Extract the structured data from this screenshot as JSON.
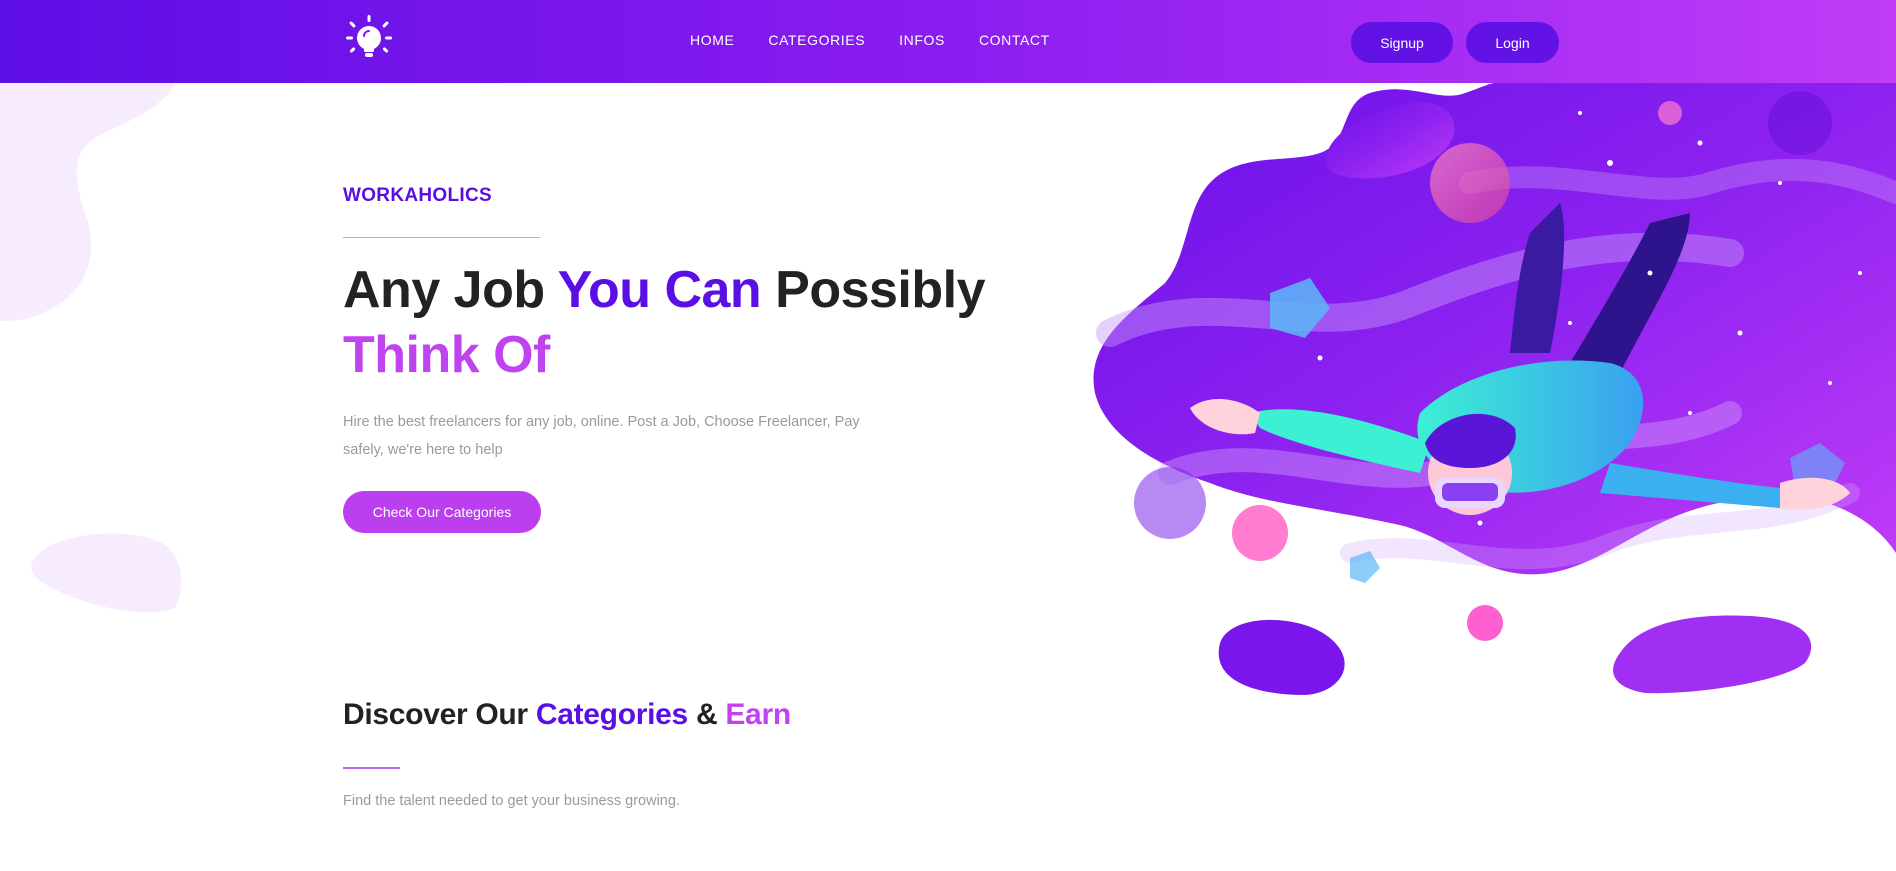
{
  "header": {
    "logo_icon": "lightbulb-icon",
    "nav": [
      {
        "label": "HOME"
      },
      {
        "label": "CATEGORIES"
      },
      {
        "label": "INFOS"
      },
      {
        "label": "CONTACT"
      }
    ],
    "signup_label": "Signup",
    "login_label": "Login"
  },
  "hero": {
    "eyebrow": "WORKAHOLICS",
    "title_part1": "Any Job ",
    "title_part2": "You Can",
    "title_part3": " Possibly",
    "title_part4": " Think Of",
    "description": "Hire the best freelancers for any job, online. Post a Job, Choose Freelancer, Pay safely, we're here to help",
    "cta_label": "Check Our Categories"
  },
  "section": {
    "title_part1": "Discover Our ",
    "title_part2": "Categories",
    "title_part3": " & ",
    "title_part4": "Earn",
    "description": "Find the talent needed to get your business growing."
  },
  "colors": {
    "header_gradient_start": "#5e0ee6",
    "header_gradient_end": "#c03cf7",
    "accent_purple": "#5a10e4",
    "accent_pink": "#c043f0"
  }
}
